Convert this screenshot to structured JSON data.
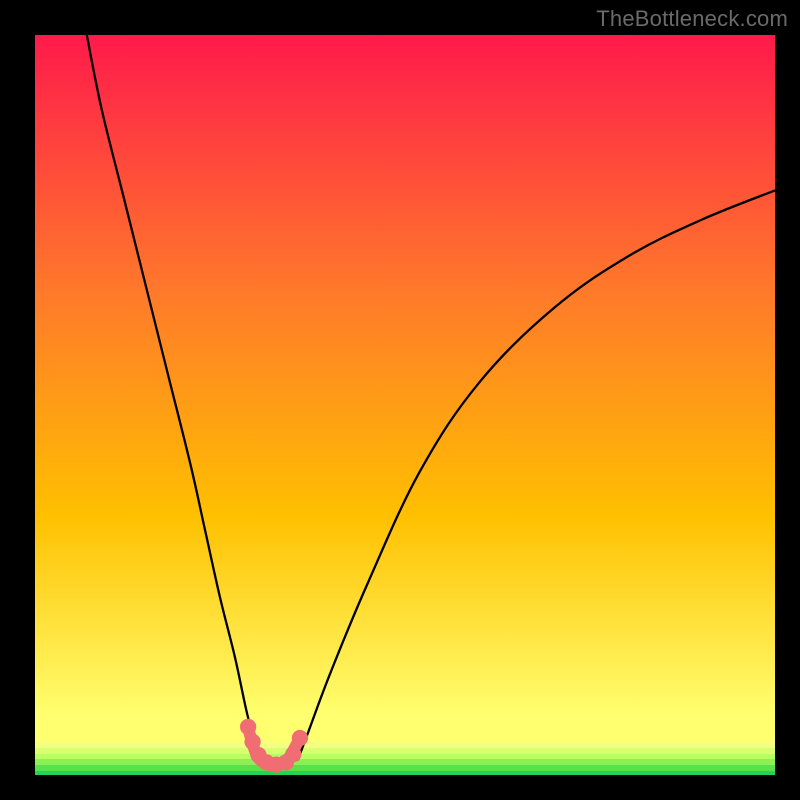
{
  "watermark": {
    "text": "TheBottleneck.com"
  },
  "chart_data": {
    "type": "line",
    "title": "",
    "xlabel": "",
    "ylabel": "",
    "xlim": [
      0,
      100
    ],
    "ylim": [
      0,
      100
    ],
    "background_gradient": {
      "top": "#ff1a4b",
      "mid": "#ffc000",
      "bottom": "#ffff70"
    },
    "bottom_bands": [
      {
        "color": "#f2ff80",
        "y": 95.5,
        "h": 0.8
      },
      {
        "color": "#d8ff70",
        "y": 96.3,
        "h": 0.8
      },
      {
        "color": "#b8ff60",
        "y": 97.1,
        "h": 0.8
      },
      {
        "color": "#8cf054",
        "y": 97.9,
        "h": 0.8
      },
      {
        "color": "#56e24c",
        "y": 98.7,
        "h": 0.8
      },
      {
        "color": "#22d455",
        "y": 99.5,
        "h": 0.5
      }
    ],
    "series": [
      {
        "name": "left-branch",
        "x": [
          7,
          9,
          12,
          15,
          18,
          21,
          23,
          25,
          27,
          28.5,
          29.5,
          30.2
        ],
        "values": [
          100,
          90,
          78,
          66,
          54,
          42,
          33,
          24,
          16,
          9,
          5,
          2
        ]
      },
      {
        "name": "right-branch",
        "x": [
          35.5,
          37,
          40,
          45,
          52,
          60,
          70,
          80,
          90,
          100
        ],
        "values": [
          2,
          6,
          14,
          26,
          41,
          53,
          63,
          70,
          75,
          79
        ]
      }
    ],
    "valley_markers": {
      "color": "#ef6d73",
      "radius": 1.1,
      "points": [
        {
          "x": 28.8,
          "y": 6.5
        },
        {
          "x": 29.4,
          "y": 4.5
        },
        {
          "x": 30.2,
          "y": 2.7
        },
        {
          "x": 31.3,
          "y": 1.7
        },
        {
          "x": 32.6,
          "y": 1.4
        },
        {
          "x": 33.9,
          "y": 1.7
        },
        {
          "x": 34.9,
          "y": 2.8
        },
        {
          "x": 35.8,
          "y": 5.0
        }
      ]
    },
    "valley_curve": {
      "color": "#ef6d73",
      "width": 1.6,
      "x": [
        28.8,
        30.0,
        31.5,
        32.8,
        34.2,
        35.8
      ],
      "values": [
        6.3,
        2.6,
        1.4,
        1.3,
        2.2,
        5.0
      ]
    }
  }
}
